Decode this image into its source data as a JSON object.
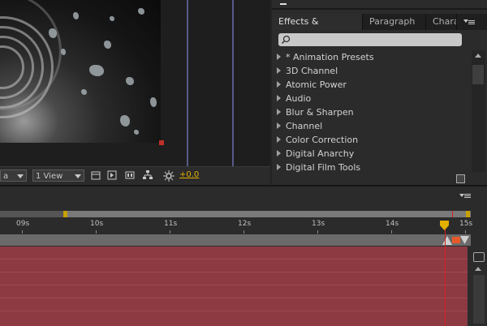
{
  "viewer": {
    "magnification_label": "a",
    "view_layout": "1 View",
    "exposure": "+0.0"
  },
  "effects_panel": {
    "tabs": [
      {
        "label": "Effects & Presets",
        "active": true,
        "closable": true
      },
      {
        "label": "Paragraph",
        "active": false
      },
      {
        "label": "Chara",
        "active": false
      }
    ],
    "search_placeholder": "",
    "items": [
      "* Animation Presets",
      "3D Channel",
      "Atomic Power",
      "Audio",
      "Blur & Sharpen",
      "Channel",
      "Color Correction",
      "Digital Anarchy",
      "Digital Film Tools"
    ]
  },
  "timeline": {
    "ruler_labels": [
      "09s",
      "10s",
      "11s",
      "12s",
      "13s",
      "14s",
      "15s"
    ],
    "current_time_seconds": 14.72,
    "accent_color": "#d82020",
    "layer_color": "#8d3a43"
  }
}
